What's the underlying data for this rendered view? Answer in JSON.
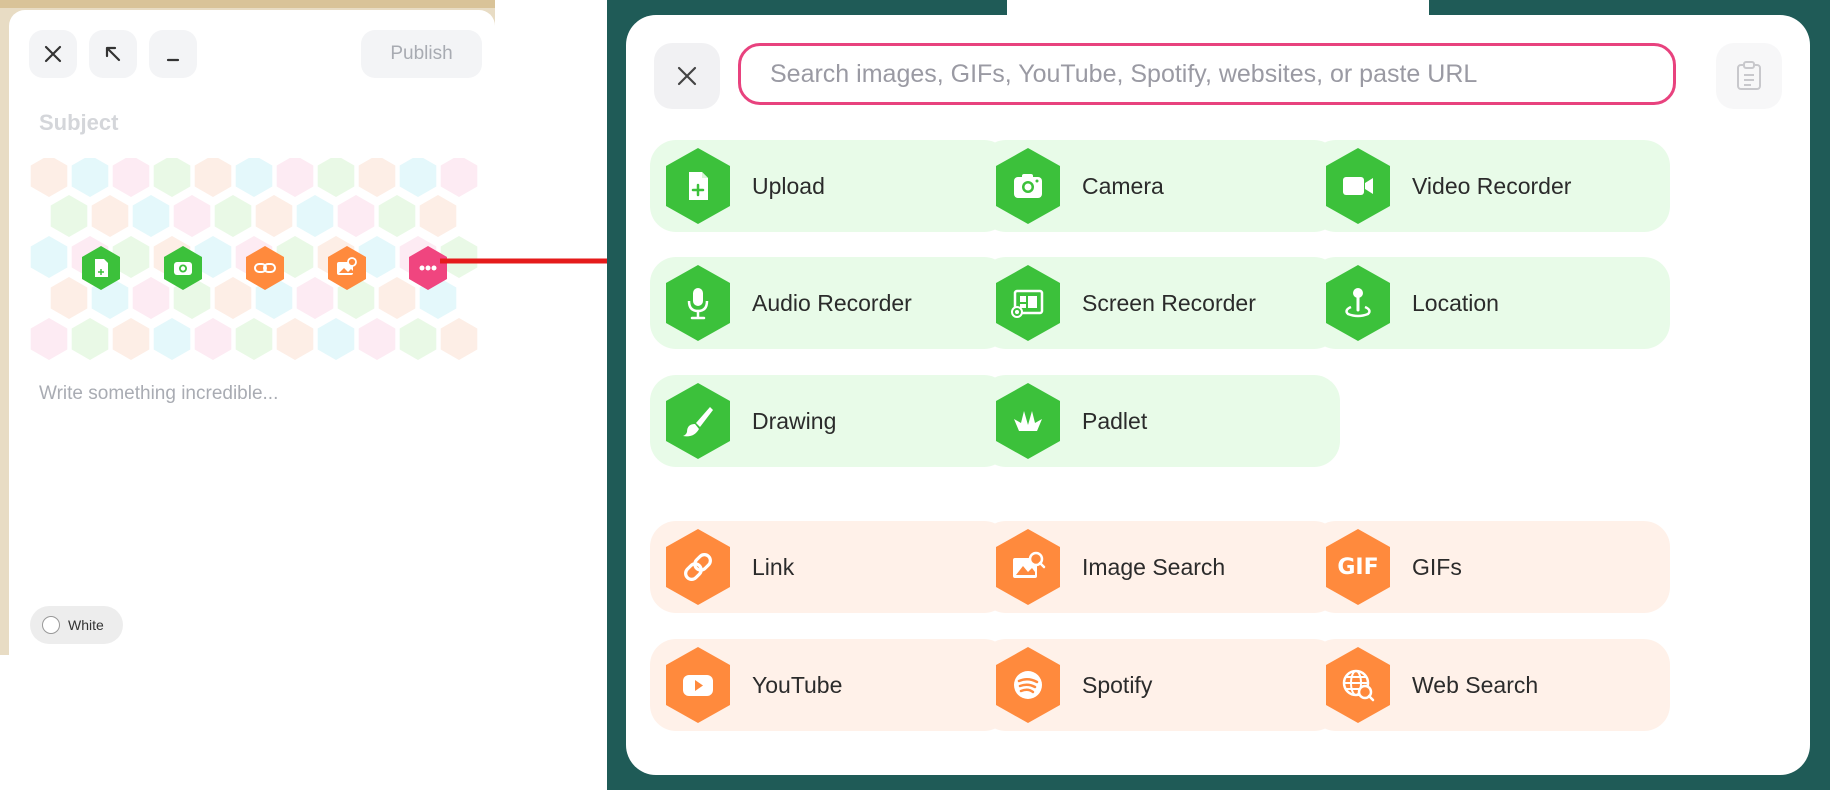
{
  "composer": {
    "close_icon": "close-icon",
    "expand_icon": "expand-arrow-icon",
    "minimize_icon": "minimize-icon",
    "publish_label": "Publish",
    "subject_placeholder": "Subject",
    "body_placeholder": "Write something incredible...",
    "color_label": "White",
    "quick_attach_icons": [
      "upload-icon",
      "camera-icon",
      "link-icon",
      "image-search-icon",
      "more-icon"
    ]
  },
  "attachment_panel": {
    "search_placeholder": "Search images, GIFs, YouTube, Spotify, websites, or paste URL",
    "close_icon": "close-icon",
    "clipboard_icon": "clipboard-icon",
    "record_section": [
      {
        "label": "Upload",
        "icon": "file-upload-icon"
      },
      {
        "label": "Camera",
        "icon": "camera-icon"
      },
      {
        "label": "Video Recorder",
        "icon": "video-camera-icon"
      },
      {
        "label": "Audio Recorder",
        "icon": "microphone-icon"
      },
      {
        "label": "Screen Recorder",
        "icon": "screen-recorder-icon"
      },
      {
        "label": "Location",
        "icon": "location-pin-icon"
      },
      {
        "label": "Drawing",
        "icon": "paintbrush-icon"
      },
      {
        "label": "Padlet",
        "icon": "padlet-bird-icon"
      }
    ],
    "search_section": [
      {
        "label": "Link",
        "icon": "link-icon"
      },
      {
        "label": "Image Search",
        "icon": "image-search-icon"
      },
      {
        "label": "GIFs",
        "icon": "gif-icon",
        "icon_text": "GIF"
      },
      {
        "label": "YouTube",
        "icon": "youtube-icon"
      },
      {
        "label": "Spotify",
        "icon": "spotify-icon"
      },
      {
        "label": "Web Search",
        "icon": "web-search-icon"
      }
    ]
  },
  "colors": {
    "green": "#3cc13b",
    "green_tile": "#e8fbe8",
    "orange": "#ff8a3d",
    "orange_tile": "#fff1e9",
    "pink": "#f0457f",
    "search_border": "#e8427e",
    "arrow": "#e51b1b",
    "panel_bg": "#1f5b57"
  }
}
